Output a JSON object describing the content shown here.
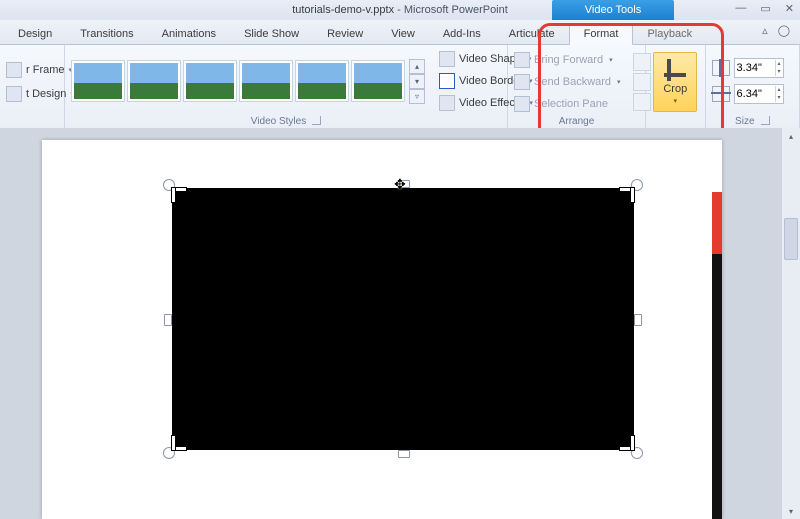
{
  "title": {
    "filename": "tutorials-demo-v.pptx",
    "app": "Microsoft PowerPoint"
  },
  "contextual_tab": "Video Tools",
  "tabs": [
    "Design",
    "Transitions",
    "Animations",
    "Slide Show",
    "Review",
    "View",
    "Add-Ins",
    "Articulate",
    "Format",
    "Playback"
  ],
  "adjust": {
    "line1": "r Frame",
    "line2": "t Design"
  },
  "styles": {
    "cmds": {
      "shape": "Video Shape",
      "border": "Video Border",
      "effects": "Video Effects"
    },
    "label": "Video Styles"
  },
  "arrange": {
    "forward": "Bring Forward",
    "backward": "Send Backward",
    "pane": "Selection Pane",
    "label": "Arrange"
  },
  "crop": {
    "label": "Crop"
  },
  "size": {
    "height": "3.34\"",
    "width": "6.34\"",
    "label": "Size"
  }
}
